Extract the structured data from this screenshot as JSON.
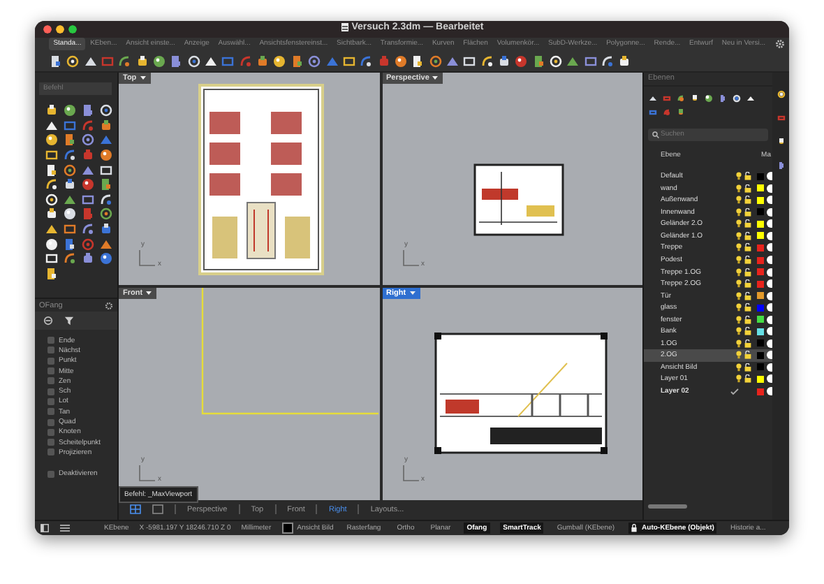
{
  "window": {
    "title": "Versuch 2.3dm — Bearbeitet"
  },
  "toolbar_tabs": [
    {
      "label": "Standa...",
      "selected": true
    },
    {
      "label": "KEben...",
      "selected": false
    },
    {
      "label": "Ansicht einste...",
      "selected": false
    },
    {
      "label": "Anzeige",
      "selected": false
    },
    {
      "label": "Auswähl...",
      "selected": false
    },
    {
      "label": "Ansichtsfenstereinst...",
      "selected": false
    },
    {
      "label": "Sichtbark...",
      "selected": false
    },
    {
      "label": "Transformie...",
      "selected": false
    },
    {
      "label": "Kurven",
      "selected": false
    },
    {
      "label": "Flächen",
      "selected": false
    },
    {
      "label": "Volumenkör...",
      "selected": false
    },
    {
      "label": "SubD-Werkze...",
      "selected": false
    },
    {
      "label": "Polygonne...",
      "selected": false
    },
    {
      "label": "Rende...",
      "selected": false
    },
    {
      "label": "Entwurf",
      "selected": false
    },
    {
      "label": "Neu in Versi...",
      "selected": false
    }
  ],
  "command": {
    "placeholder": "Befehl"
  },
  "osnap": {
    "title": "OFang",
    "items": [
      {
        "label": "Ende",
        "checked": false
      },
      {
        "label": "Nächst",
        "checked": false
      },
      {
        "label": "Punkt",
        "checked": false
      },
      {
        "label": "Mitte",
        "checked": false
      },
      {
        "label": "Zen",
        "checked": false
      },
      {
        "label": "Sch",
        "checked": false
      },
      {
        "label": "Lot",
        "checked": false
      },
      {
        "label": "Tan",
        "checked": false
      },
      {
        "label": "Quad",
        "checked": false
      },
      {
        "label": "Knoten",
        "checked": false
      },
      {
        "label": "Scheitelpunkt",
        "checked": false
      },
      {
        "label": "Projizieren",
        "checked": false
      }
    ],
    "disable": {
      "label": "Deaktivieren",
      "checked": false
    }
  },
  "viewports": [
    {
      "title": "Top",
      "kind": "plan",
      "selected": false,
      "axes": [
        "y",
        "x"
      ]
    },
    {
      "title": "Perspective",
      "kind": "perspective",
      "selected": false,
      "axes": [
        "y",
        "x"
      ]
    },
    {
      "title": "Front",
      "kind": "front",
      "selected": false,
      "axes": [
        "y",
        "x"
      ]
    },
    {
      "title": "Right",
      "kind": "section",
      "selected": true,
      "axes": [
        "y",
        "x"
      ]
    }
  ],
  "tooltip": "Befehl: _MaxViewport",
  "viewport_tabs": [
    {
      "label": "Perspective",
      "selected": false
    },
    {
      "label": "Top",
      "selected": false
    },
    {
      "label": "Front",
      "selected": false
    },
    {
      "label": "Right",
      "selected": true
    },
    {
      "label": "Layouts...",
      "selected": false
    }
  ],
  "layers": {
    "title": "Ebenen",
    "search": {
      "placeholder": "Suchen"
    },
    "columns": [
      "Ebene",
      "Ma"
    ],
    "rows": [
      {
        "name": "Default",
        "color": "#000000",
        "selected": false,
        "current": false
      },
      {
        "name": "wand",
        "color": "#ffff00",
        "selected": false,
        "current": false
      },
      {
        "name": "Außenwand",
        "color": "#ffff00",
        "selected": false,
        "current": false
      },
      {
        "name": "Innenwand",
        "color": "#000000",
        "selected": false,
        "current": false
      },
      {
        "name": "Geländer 2.O",
        "color": "#ffff00",
        "selected": false,
        "current": false
      },
      {
        "name": "Geländer 1.O",
        "color": "#ffff00",
        "selected": false,
        "current": false
      },
      {
        "name": "Treppe",
        "color": "#e8231c",
        "selected": false,
        "current": false
      },
      {
        "name": "Podest",
        "color": "#e8231c",
        "selected": false,
        "current": false
      },
      {
        "name": "Treppe 1.OG",
        "color": "#e8231c",
        "selected": false,
        "current": false
      },
      {
        "name": "Treppe 2.OG",
        "color": "#e8231c",
        "selected": false,
        "current": false
      },
      {
        "name": "Tür",
        "color": "#e39a2a",
        "selected": false,
        "current": false
      },
      {
        "name": "glass",
        "color": "#0000ff",
        "selected": false,
        "current": false
      },
      {
        "name": "fenster",
        "color": "#44dd44",
        "selected": false,
        "current": false
      },
      {
        "name": "Bank",
        "color": "#66e0e6",
        "selected": false,
        "current": false
      },
      {
        "name": "1.OG",
        "color": "#000000",
        "selected": false,
        "current": false
      },
      {
        "name": "2.OG",
        "color": "#000000",
        "selected": true,
        "current": false
      },
      {
        "name": "Ansicht Bild",
        "color": "#000000",
        "selected": false,
        "current": false
      },
      {
        "name": "Layer 01",
        "color": "#ffff00",
        "selected": false,
        "current": false
      },
      {
        "name": "Layer 02",
        "color": "#e8231c",
        "selected": false,
        "current": true
      }
    ]
  },
  "status_bar": [
    {
      "kind": "text",
      "label": "KEbene"
    },
    {
      "kind": "text",
      "label": "X -5981.197 Y 18246.710 Z 0"
    },
    {
      "kind": "text",
      "label": "Millimeter"
    },
    {
      "kind": "layer",
      "label": "Ansicht Bild",
      "color": "#000000"
    },
    {
      "kind": "toggle",
      "label": "Rasterfang",
      "on": false
    },
    {
      "kind": "toggle",
      "label": "Ortho",
      "on": false
    },
    {
      "kind": "toggle",
      "label": "Planar",
      "on": false
    },
    {
      "kind": "toggle",
      "label": "Ofang",
      "on": true
    },
    {
      "kind": "toggle",
      "label": "SmartTrack",
      "on": true
    },
    {
      "kind": "toggle",
      "label": "Gumball (KEbene)",
      "on": false
    },
    {
      "kind": "lock",
      "label": "Auto-KEbene (Objekt)",
      "on": true
    },
    {
      "kind": "toggle",
      "label": "Historie a...",
      "on": false
    }
  ]
}
